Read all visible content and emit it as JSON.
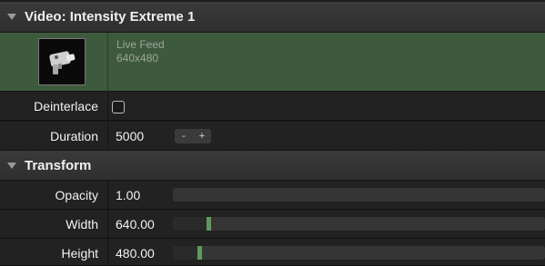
{
  "video_section": {
    "title": "Video: Intensity Extreme 1",
    "thumbnail_icon": "video-camera-icon",
    "feed": {
      "line1": "Live Feed",
      "line2": "640x480"
    }
  },
  "rows": {
    "deinterlace": {
      "label": "Deinterlace",
      "checked": false
    },
    "duration": {
      "label": "Duration",
      "value": "5000",
      "decrement": "-",
      "increment": "+"
    }
  },
  "transform_section": {
    "title": "Transform",
    "opacity": {
      "label": "Opacity",
      "value": "1.00",
      "level": 0.0
    },
    "width": {
      "label": "Width",
      "value": "640.00",
      "level": 0.09
    },
    "height": {
      "label": "Height",
      "value": "480.00",
      "level": 0.065
    }
  },
  "colors": {
    "feed_background": "#3d5a3c",
    "slider_thumb": "#5e9b5a"
  }
}
